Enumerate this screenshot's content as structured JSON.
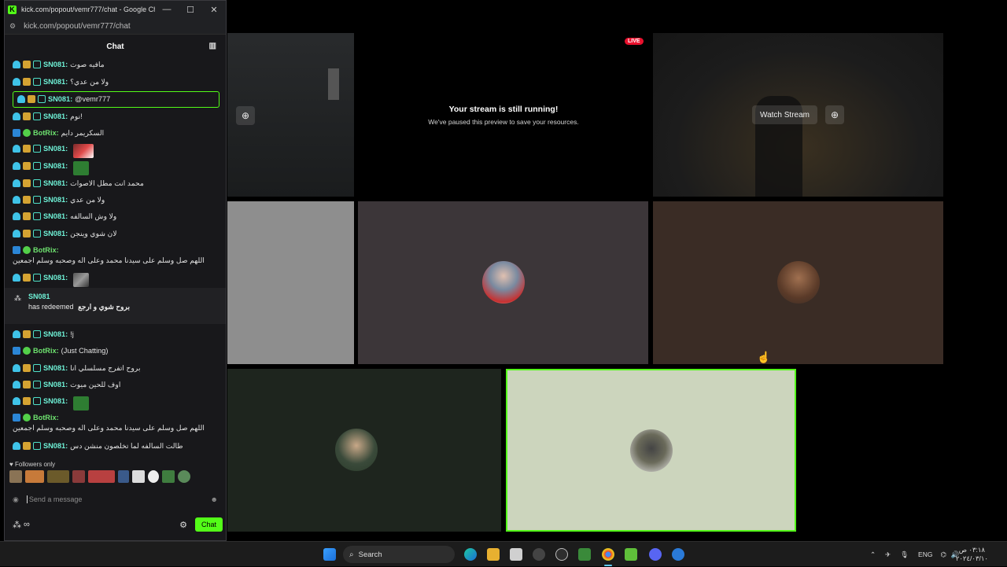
{
  "window": {
    "title": "kick.com/popout/vemr777/chat - Google Chro...",
    "url": "kick.com/popout/vemr777/chat",
    "controls": {
      "minimize": "—",
      "maximize": "☐",
      "close": "✕"
    }
  },
  "chat": {
    "header": "Chat",
    "messages": [
      {
        "user": "SN081:",
        "text": "مافيه صوت"
      },
      {
        "user": "SN081:",
        "text": "ولا من عدي؟"
      },
      {
        "user": "SN081:",
        "text": "@vemr777"
      },
      {
        "user": "SN081:",
        "text": "نوم!"
      },
      {
        "user": "BotRix:",
        "text": "السكريمر دايم"
      },
      {
        "user": "SN081:",
        "text": ""
      },
      {
        "user": "SN081:",
        "text": ""
      },
      {
        "user": "SN081:",
        "text": "محمد انت مطل الاصوات"
      },
      {
        "user": "SN081:",
        "text": "ولا من عدي"
      },
      {
        "user": "SN081:",
        "text": "ولا وش السالفه"
      },
      {
        "user": "SN081:",
        "text": "لان شوي وينجن"
      },
      {
        "user": "BotRix:",
        "text": "اللهم صل وسلم على سيدنا محمد وعلى اله وصحبه وسلم اجمعين"
      },
      {
        "user": "SN081:",
        "text": ""
      },
      {
        "user": "SN081:",
        "text": "!j"
      },
      {
        "user": "BotRix:",
        "text": "(Just Chatting)"
      },
      {
        "user": "SN081:",
        "text": "بروح اتفرج مسلسلي انا"
      },
      {
        "user": "SN081:",
        "text": "اوف للحين ميوت"
      },
      {
        "user": "SN081:",
        "text": ""
      },
      {
        "user": "BotRix:",
        "text": "اللهم صل وسلم على سيدنا محمد وعلى اله وصحبه وسلم اجمعين"
      },
      {
        "user": "SN081:",
        "text": "طالت السالفه لما تخلصون منشن دس"
      }
    ],
    "redeem": {
      "user": "SN081",
      "action": "has redeemed",
      "reward": "بروح شوي و ارجع"
    },
    "followers_only": "Followers only",
    "input_placeholder": "Send a message",
    "points": "∞",
    "send_label": "Chat"
  },
  "stage": {
    "live": "LIVE",
    "paused_title": "Your stream is still running!",
    "paused_sub": "We've paused this preview to save your resources.",
    "watch_stream": "Watch Stream"
  },
  "taskbar": {
    "search": "Search",
    "lang": "ENG",
    "time": "٠٣:١٨ ص",
    "date": "٢٠٢٤/٠٣/١٠"
  },
  "colors": {
    "kick_green": "#53fc18",
    "username": "#6ff2d7",
    "bot_name": "#6ee26f"
  },
  "icons": [
    "kick-favicon",
    "tune-icon",
    "leaderboard-icon",
    "subscriber-badge",
    "crown-badge",
    "og-badge",
    "bot-badge",
    "verified-badge",
    "magnify-icon",
    "heart-icon",
    "emoji-icon",
    "gear-icon",
    "windows-start-icon",
    "search-icon"
  ]
}
